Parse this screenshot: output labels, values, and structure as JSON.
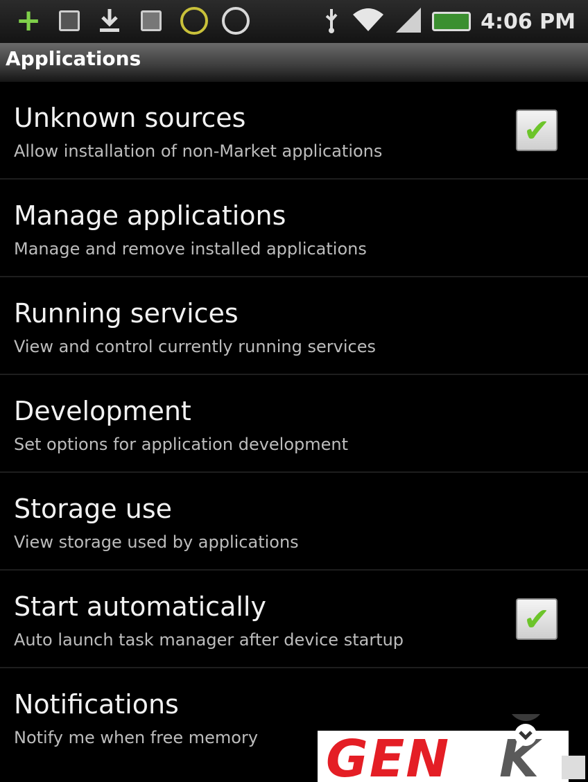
{
  "status_bar": {
    "time": "4:06 PM",
    "icons": [
      "plus-icon",
      "image-icon",
      "download-icon",
      "sim-icon",
      "ring-icon",
      "power-icon",
      "usb-icon",
      "wifi-icon",
      "signal-icon",
      "battery-icon"
    ]
  },
  "section_header": "Applications",
  "items": [
    {
      "title": "Unknown sources",
      "summary": "Allow installation of non-Market applications",
      "checked": true
    },
    {
      "title": "Manage applications",
      "summary": "Manage and remove installed applications",
      "checked": null
    },
    {
      "title": "Running services",
      "summary": "View and control currently running services",
      "checked": null
    },
    {
      "title": "Development",
      "summary": "Set options for application development",
      "checked": null
    },
    {
      "title": "Storage use",
      "summary": "View storage used by applications",
      "checked": null
    },
    {
      "title": "Start automatically",
      "summary": "Auto launch task manager after device startup",
      "checked": true
    },
    {
      "title": "Notifications",
      "summary": "Notify me when free memory",
      "checked": null
    }
  ],
  "watermark": {
    "text": "GENK"
  },
  "colors": {
    "background": "#000000",
    "check": "#6cc42a",
    "watermark": "#e41e25"
  }
}
